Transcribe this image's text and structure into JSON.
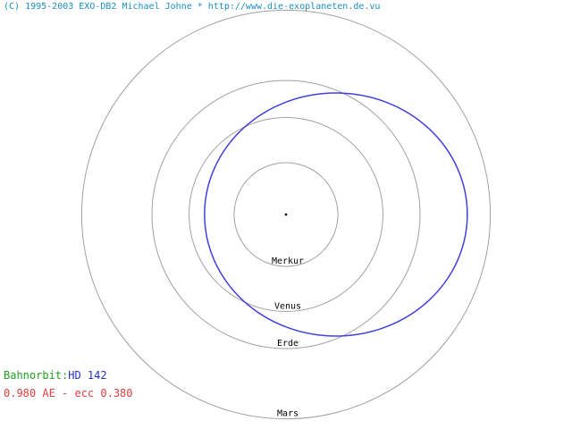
{
  "header": {
    "copyright": "(C) 1995-2003 EXO-DB2 Michael Johne * http://www.die-exoplaneten.de.vu",
    "copyright_color": "#1a8fbf"
  },
  "solar_system": {
    "orbit_color": "#a0a0a0",
    "label_color": "#000000",
    "orbits": [
      {
        "name": "Merkur",
        "radius_au": 0.387
      },
      {
        "name": "Venus",
        "radius_au": 0.723
      },
      {
        "name": "Erde",
        "radius_au": 1.0
      },
      {
        "name": "Mars",
        "radius_au": 1.524
      }
    ]
  },
  "planet_orbit": {
    "semi_major_axis_au": 0.98,
    "eccentricity": 0.38,
    "color": "#4040e0"
  },
  "info": {
    "label": "Bahnorbit:",
    "label_color": "#20a020",
    "planet_name": "HD 142",
    "planet_name_color": "#2030c0",
    "params": "0.980 AE - ecc 0.380",
    "params_color": "#e04040"
  }
}
